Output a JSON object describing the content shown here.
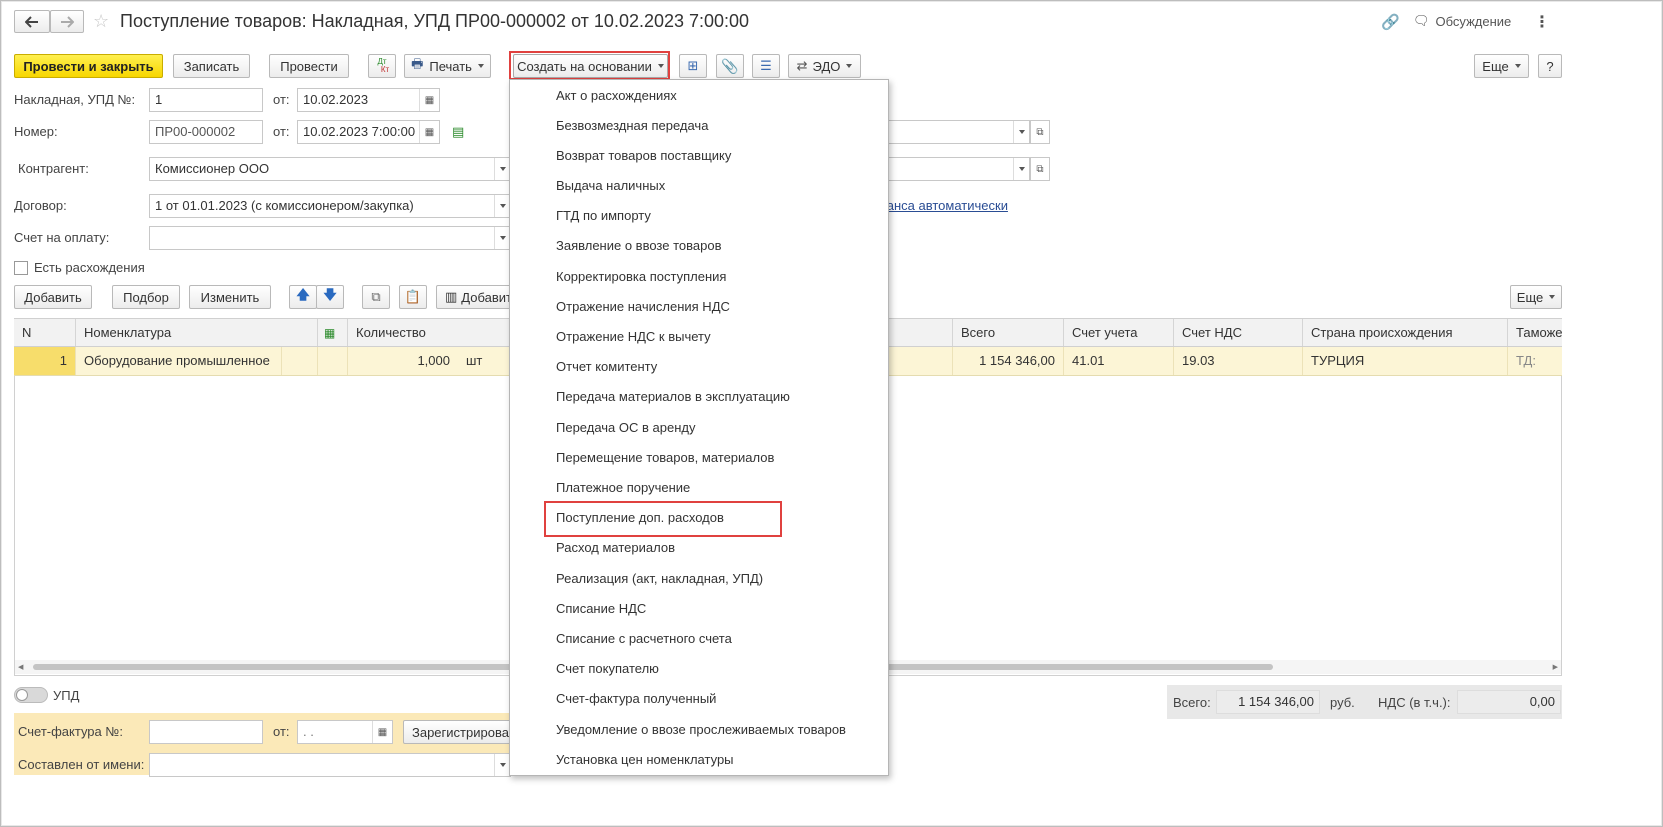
{
  "window": {
    "title": "Поступление товаров: Накладная, УПД ПР00-000002 от 10.02.2023 7:00:00",
    "discussion_label": "Обсуждение"
  },
  "toolbar": {
    "post_close": "Провести и закрыть",
    "save": "Записать",
    "post": "Провести",
    "dtkt_top": "Дт",
    "dtkt_bottom": "Кт",
    "print": "Печать",
    "create_based": "Создать на основании",
    "edo": "ЭДО",
    "more": "Еще",
    "help": "?"
  },
  "form": {
    "invoice_label": "Накладная, УПД №:",
    "invoice_value": "1",
    "from_label": "от:",
    "invoice_date": "10.02.2023",
    "number_label": "Номер:",
    "number_value": "ПР00-000002",
    "number_date": "10.02.2023  7:00:00",
    "counterparty_label": "Контрагент:",
    "counterparty_value": "Комиссионер ООО",
    "contract_label": "Договор:",
    "contract_value": "1 от 01.01.2023 (с комиссионером/закупка)",
    "payment_label": "Счет на оплату:",
    "payment_value": "",
    "discrepancy_label": "Есть расхождения",
    "advance_link": "ванса автоматически"
  },
  "table_toolbar": {
    "add": "Добавить",
    "pick": "Подбор",
    "change": "Изменить",
    "add_barcode": "Добавит",
    "more": "Еще"
  },
  "table": {
    "headers": {
      "n": "N",
      "nomenclature": "Номенклатура",
      "qty": "Количество",
      "total": "Всего",
      "account": "Счет учета",
      "vat_account": "Счет НДС",
      "country": "Страна происхождения",
      "customs": "Таможен"
    },
    "rows": [
      {
        "n": "1",
        "nomenclature": "Оборудование промышленное",
        "qty": "1,000",
        "unit": "шт",
        "total": "1 154 346,00",
        "account": "41.01",
        "vat_account": "19.03",
        "country": "ТУРЦИЯ",
        "customs": "ТД:"
      }
    ]
  },
  "menu": {
    "items": [
      "Акт о расхождениях",
      "Безвозмездная передача",
      "Возврат товаров поставщику",
      "Выдача наличных",
      "ГТД по импорту",
      "Заявление о ввозе товаров",
      "Корректировка поступления",
      "Отражение начисления НДС",
      "Отражение НДС к вычету",
      "Отчет комитенту",
      "Передача материалов в эксплуатацию",
      "Передача ОС в аренду",
      "Перемещение товаров, материалов",
      "Платежное поручение",
      "Поступление доп. расходов",
      "Расход материалов",
      "Реализация (акт, накладная, УПД)",
      "Списание НДС",
      "Списание с расчетного счета",
      "Счет покупателю",
      "Счет-фактура полученный",
      "Уведомление о ввозе прослеживаемых товаров",
      "Установка цен номенклатуры"
    ],
    "highlighted": "Поступление доп. расходов"
  },
  "footer": {
    "upd_label": "УПД",
    "invoice_label": "Счет-фактура №:",
    "from_label": "от:",
    "invoice_date": " .  .",
    "register": "Зарегистрирова",
    "issued_label": "Составлен от имени:",
    "total_label": "Всего:",
    "total_value": "1 154 346,00",
    "currency": "руб.",
    "vat_label": "НДС (в т.ч.):",
    "vat_value": "0,00"
  },
  "colors": {
    "accent_yellow": "#f7d600",
    "highlight_red": "#e0413f",
    "row_selected": "#fcf5d6",
    "footer_band": "#fbe9b8"
  }
}
